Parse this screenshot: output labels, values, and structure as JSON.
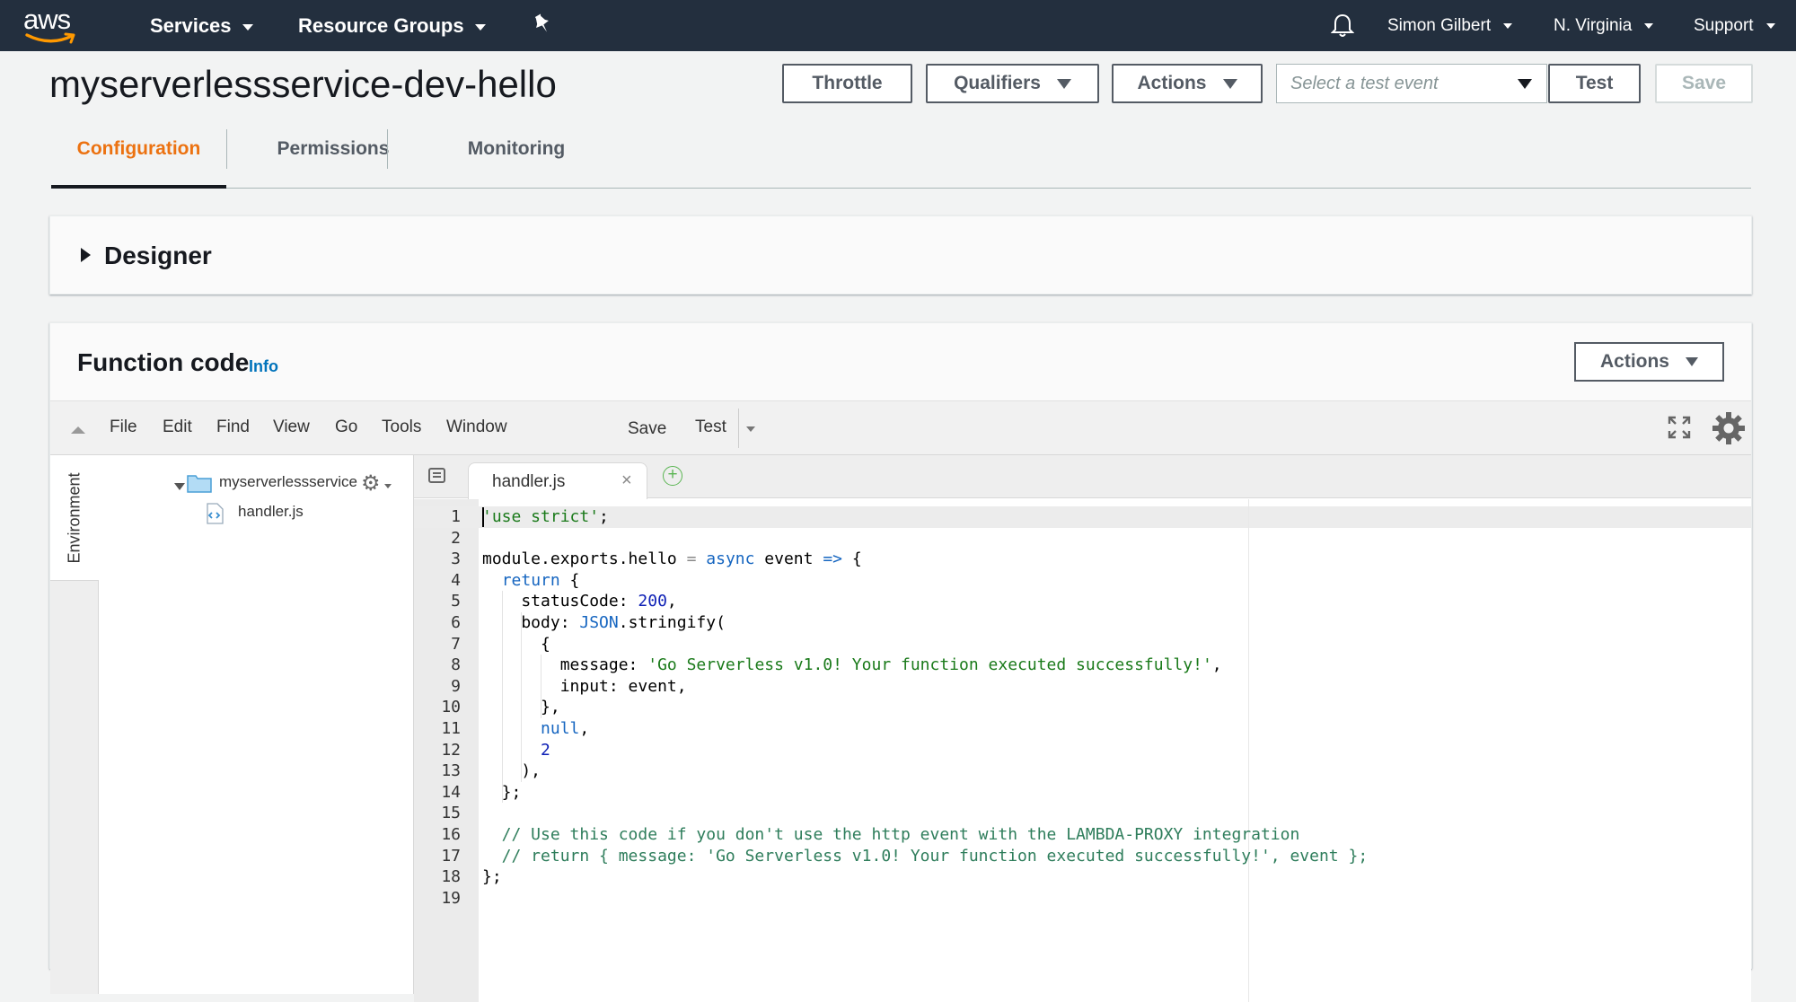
{
  "topnav": {
    "logo_text": "aws",
    "services": "Services",
    "resource_groups": "Resource Groups",
    "user": "Simon Gilbert",
    "region": "N. Virginia",
    "support": "Support"
  },
  "header": {
    "title": "myserverlessservice-dev-hello",
    "throttle": "Throttle",
    "qualifiers": "Qualifiers",
    "actions": "Actions",
    "test_event_placeholder": "Select a test event",
    "test": "Test",
    "save": "Save"
  },
  "tabs": [
    "Configuration",
    "Permissions",
    "Monitoring"
  ],
  "designer": {
    "title": "Designer"
  },
  "function_code": {
    "title": "Function code",
    "info": "Info",
    "actions": "Actions"
  },
  "ide": {
    "menu": [
      "File",
      "Edit",
      "Find",
      "View",
      "Go",
      "Tools",
      "Window"
    ],
    "save": "Save",
    "test": "Test",
    "environment_tab": "Environment",
    "tree_root": "myserverlessservice",
    "tree_file": "handler.js",
    "open_tab": "handler.js",
    "code_lines": [
      "'use strict';",
      "",
      "module.exports.hello = async event => {",
      "  return {",
      "    statusCode: 200,",
      "    body: JSON.stringify(",
      "      {",
      "        message: 'Go Serverless v1.0! Your function executed successfully!',",
      "        input: event,",
      "      },",
      "      null,",
      "      2",
      "    ),",
      "  };",
      "",
      "  // Use this code if you don't use the http event with the LAMBDA-PROXY integration",
      "  // return { message: 'Go Serverless v1.0! Your function executed successfully!', event };",
      "};",
      ""
    ]
  },
  "colors": {
    "nav_bg": "#232f3e",
    "active_tab": "#ec7211",
    "link": "#0073bb",
    "string": "#1a7a1a",
    "keyword": "#1565c0",
    "comment": "#2e7d5b"
  }
}
